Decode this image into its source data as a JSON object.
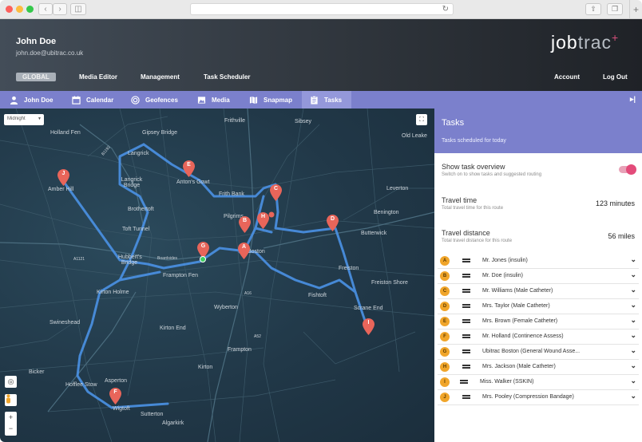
{
  "header": {
    "user_name": "John Doe",
    "user_email": "john.doe@ubitrac.co.uk",
    "logo_bold": "job",
    "logo_light": "trac",
    "logo_plus": "+",
    "nav": {
      "global": "GLOBAL",
      "media_editor": "Media Editor",
      "management": "Management",
      "task_scheduler": "Task Scheduler",
      "account": "Account",
      "logout": "Log Out"
    }
  },
  "tabs": [
    {
      "label": "John Doe",
      "icon": "person-icon"
    },
    {
      "label": "Calendar",
      "icon": "calendar-icon"
    },
    {
      "label": "Geofences",
      "icon": "geofence-icon"
    },
    {
      "label": "Media",
      "icon": "image-icon"
    },
    {
      "label": "Snapmap",
      "icon": "map-icon"
    },
    {
      "label": "Tasks",
      "icon": "clipboard-icon",
      "active": true
    }
  ],
  "map": {
    "style_select": "Midnight",
    "places": [
      "Frithville",
      "Sibsey",
      "Holland Fen",
      "Gipsey Bridge",
      "Old Leake",
      "Langrick",
      "Anton's Gowt",
      "Langrick Bridge",
      "Amber Hill",
      "Frith Bank",
      "Leverton",
      "Brothertoft",
      "Pilgrims",
      "Benington",
      "Toft Tunnel",
      "Butterwick",
      "Hubbert's Bridge",
      "Boardsides",
      "A1121",
      "Boston",
      "Frampton Fen",
      "Freiston",
      "Freiston Shore",
      "Kirton Holme",
      "Fishtoft",
      "Wyberton",
      "Scrane End",
      "Swineshead",
      "Kirton End",
      "Frampton",
      "Kirton",
      "Bicker",
      "Hofflee Stow",
      "Asperton",
      "Wigtoft",
      "Sutterton",
      "Algarkirk",
      "A52",
      "A16",
      "B1192"
    ]
  },
  "panel": {
    "title": "Tasks",
    "subtitle": "Tasks scheduled for today",
    "overview": {
      "title": "Show task overview",
      "subtitle": "Switch on to show tasks and suggested routing",
      "enabled": true
    },
    "travel_time": {
      "title": "Travel time",
      "subtitle": "Total travel time for this route",
      "value": "123 minutes"
    },
    "travel_distance": {
      "title": "Travel distance",
      "subtitle": "Total travel distance for this route",
      "value": "56 miles"
    },
    "tasks": [
      {
        "letter": "A",
        "name": "Mr. Jones (insulin)"
      },
      {
        "letter": "B",
        "name": "Mr. Doe (insulin)"
      },
      {
        "letter": "C",
        "name": "Mr. Williams (Male Catheter)"
      },
      {
        "letter": "D",
        "name": "Mrs. Taylor (Male Catheter)"
      },
      {
        "letter": "E",
        "name": "Mrs. Brown (Female Catheter)"
      },
      {
        "letter": "F",
        "name": "Mr. Holland (Continence Assess)"
      },
      {
        "letter": "G",
        "name": "Ubitrac Boston (General Wound Asse..."
      },
      {
        "letter": "H",
        "name": "Mrs. Jackson (Male Catheter)"
      },
      {
        "letter": "I",
        "name": "Miss. Walker (SSKIN)"
      },
      {
        "letter": "J",
        "name": "Mrs. Pooley (Compression Bandage)"
      }
    ]
  },
  "colors": {
    "accent": "#7b80cc",
    "route": "#4a90e2",
    "pin": "#e8655a",
    "badge": "#f0a52a",
    "toggle": "#e34b7a"
  }
}
